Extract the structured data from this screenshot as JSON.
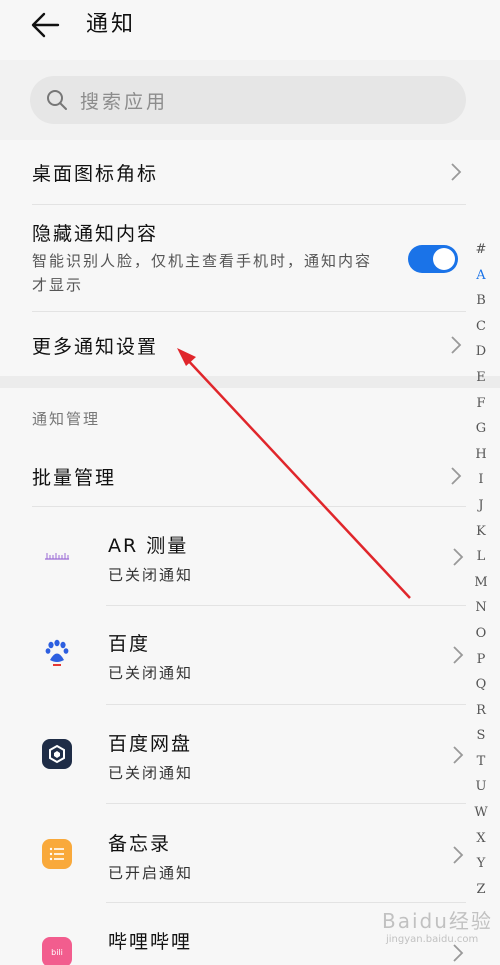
{
  "header": {
    "title": "通知",
    "back_icon": "arrow-left-icon"
  },
  "search": {
    "placeholder": "搜索应用"
  },
  "settings": {
    "badge_label": "桌面图标角标",
    "hide_label": "隐藏通知内容",
    "hide_desc": "智能识别人脸，仅机主查看手机时，通知内容才显示",
    "hide_enabled": true,
    "more_label": "更多通知设置"
  },
  "manage": {
    "section_label": "通知管理",
    "batch_label": "批量管理",
    "apps": [
      {
        "name": "AR 测量",
        "status": "已关闭通知",
        "icon": "ruler-icon"
      },
      {
        "name": "百度",
        "status": "已关闭通知",
        "icon": "baidu-paw-icon"
      },
      {
        "name": "百度网盘",
        "status": "已关闭通知",
        "icon": "baidu-netdisk-icon"
      },
      {
        "name": "备忘录",
        "status": "已开启通知",
        "icon": "notes-icon"
      },
      {
        "name": "哔哩哔哩",
        "status": "已开启通知",
        "icon": "bilibili-icon"
      }
    ]
  },
  "alphabet": [
    "#",
    "A",
    "B",
    "C",
    "D",
    "E",
    "F",
    "G",
    "H",
    "I",
    "J",
    "K",
    "L",
    "M",
    "N",
    "O",
    "P",
    "Q",
    "R",
    "S",
    "T",
    "U",
    "W",
    "X",
    "Y",
    "Z"
  ],
  "alphabet_active": "A",
  "colors": {
    "accent": "#1a73e8",
    "annotation_arrow": "#e0262b"
  },
  "watermark": {
    "text": "Baidu经验",
    "sub": "jingyan.baidu.com"
  }
}
